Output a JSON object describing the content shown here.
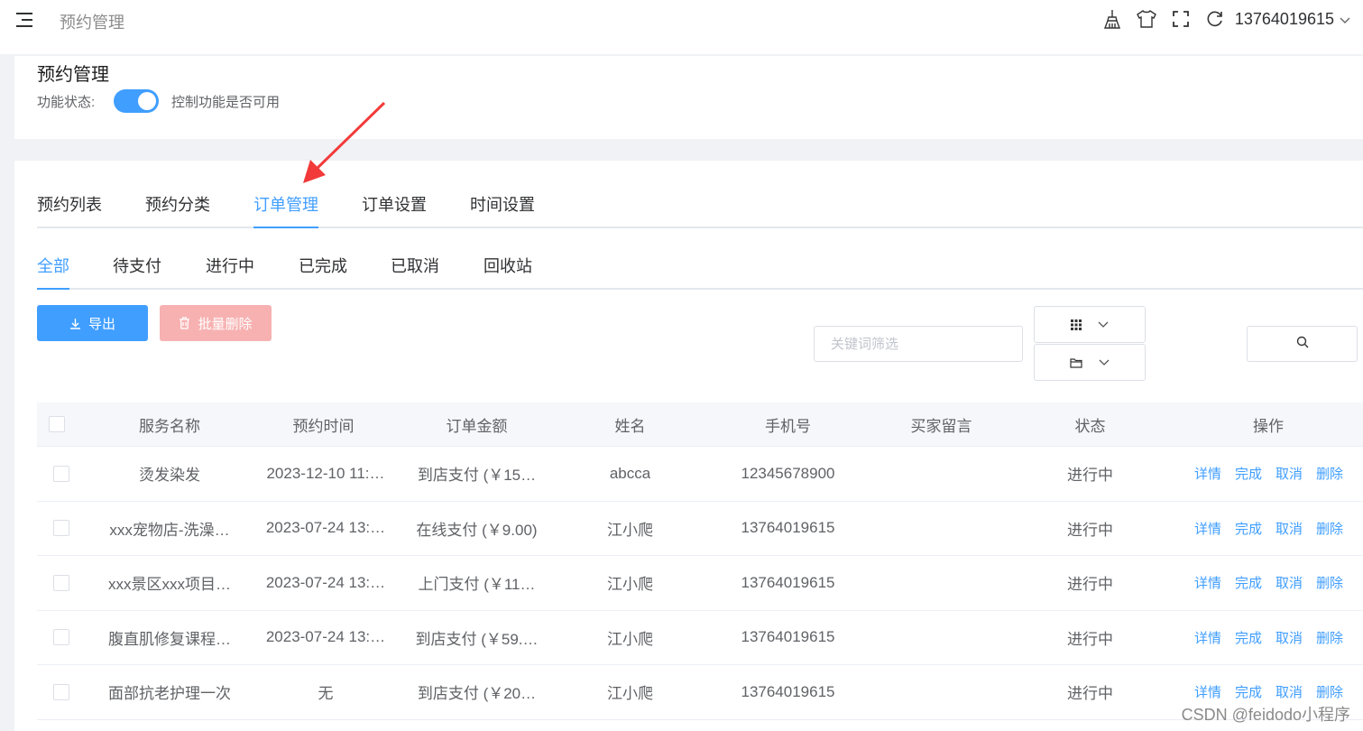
{
  "topbar": {
    "breadcrumb": "预约管理",
    "icons": [
      "broom-icon",
      "shirt-icon",
      "fullscreen-icon",
      "refresh-icon"
    ],
    "user": "13764019615"
  },
  "header": {
    "title": "预约管理",
    "status_label": "功能状态:",
    "switch_on": true,
    "switch_desc": "控制功能是否可用"
  },
  "main_tabs": [
    {
      "label": "预约列表",
      "active": false
    },
    {
      "label": "预约分类",
      "active": false
    },
    {
      "label": "订单管理",
      "active": true
    },
    {
      "label": "订单设置",
      "active": false
    },
    {
      "label": "时间设置",
      "active": false
    }
  ],
  "sub_tabs": [
    {
      "label": "全部",
      "active": true
    },
    {
      "label": "待支付",
      "active": false
    },
    {
      "label": "进行中",
      "active": false
    },
    {
      "label": "已完成",
      "active": false
    },
    {
      "label": "已取消",
      "active": false
    },
    {
      "label": "回收站",
      "active": false
    }
  ],
  "toolbar": {
    "export_label": "导出",
    "batch_delete_label": "批量删除",
    "keyword_placeholder": "关键词筛选"
  },
  "table": {
    "columns": [
      "服务名称",
      "预约时间",
      "订单金额",
      "姓名",
      "手机号",
      "买家留言",
      "状态",
      "操作"
    ],
    "rows": [
      {
        "service": "烫发染发",
        "time": "2023-12-10 11:…",
        "amount": "到店支付 (￥15…",
        "name": "abcca",
        "phone": "12345678900",
        "message": "",
        "status": "进行中"
      },
      {
        "service": "xxx宠物店-洗澡…",
        "time": "2023-07-24 13:…",
        "amount": "在线支付 (￥9.00)",
        "name": "江小爬",
        "phone": "13764019615",
        "message": "",
        "status": "进行中"
      },
      {
        "service": "xxx景区xxx项目…",
        "time": "2023-07-24 13:…",
        "amount": "上门支付 (￥11…",
        "name": "江小爬",
        "phone": "13764019615",
        "message": "",
        "status": "进行中"
      },
      {
        "service": "腹直肌修复课程…",
        "time": "2023-07-24 13:…",
        "amount": "到店支付 (￥59.…",
        "name": "江小爬",
        "phone": "13764019615",
        "message": "",
        "status": "进行中"
      },
      {
        "service": "面部抗老护理一次",
        "time": "无",
        "amount": "到店支付 (￥20…",
        "name": "江小爬",
        "phone": "13764019615",
        "message": "",
        "status": "进行中"
      }
    ],
    "actions": [
      "详情",
      "完成",
      "取消",
      "删除"
    ]
  },
  "annotation": {
    "color": "#f23a3a"
  },
  "watermark": "CSDN @feidodo小程序",
  "colors": {
    "primary": "#409eff",
    "danger_light": "#f7b1b1"
  }
}
